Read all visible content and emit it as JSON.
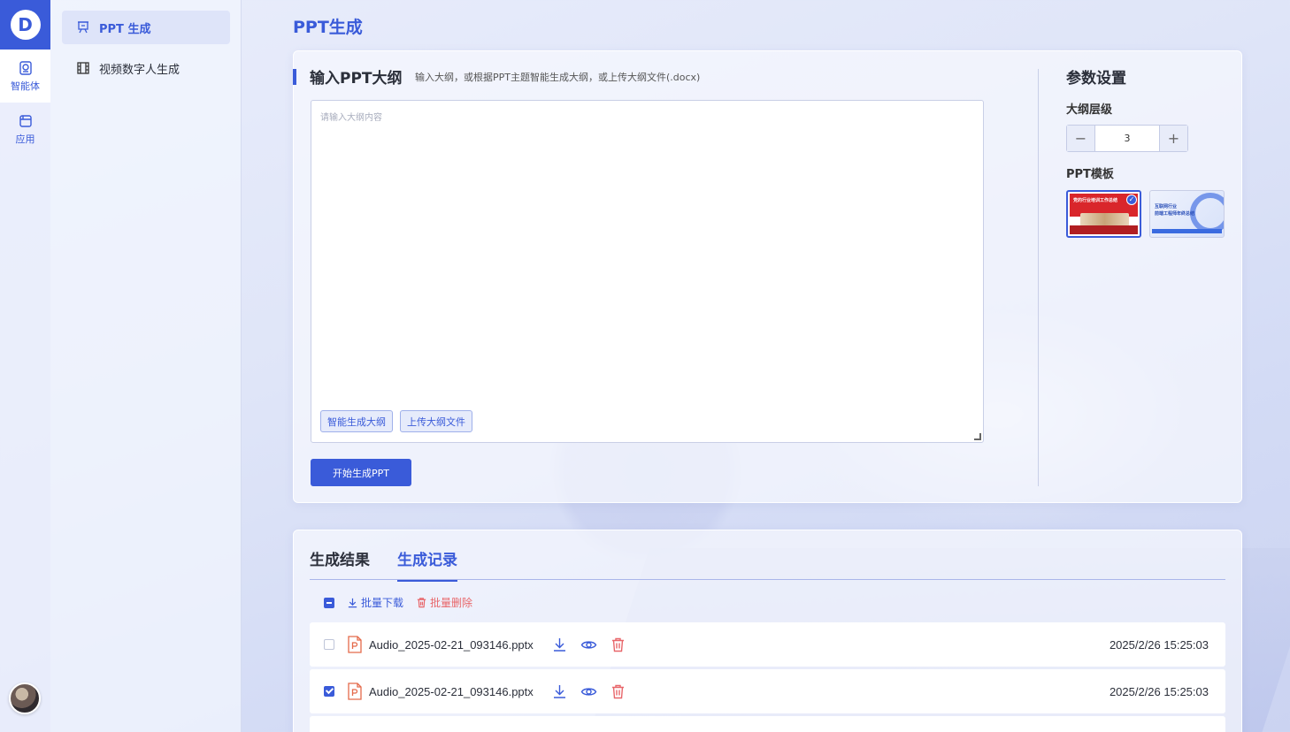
{
  "rail": {
    "items": [
      {
        "label": "智能体",
        "icon": "agent-icon"
      },
      {
        "label": "应用",
        "icon": "app-icon"
      }
    ]
  },
  "sidebar": {
    "items": [
      {
        "label": "PPT 生成",
        "icon": "presentation-icon",
        "active": true
      },
      {
        "label": "视频数字人生成",
        "icon": "film-icon",
        "active": false
      }
    ]
  },
  "page": {
    "title": "PPT生成"
  },
  "outline": {
    "title": "输入PPT大纲",
    "hint": "输入大纲，或根据PPT主题智能生成大纲，或上传大纲文件(.docx)",
    "placeholder": "请输入大纲内容",
    "smart_button": "智能生成大纲",
    "upload_button": "上传大纲文件",
    "start_button": "开始生成PPT"
  },
  "params": {
    "title": "参数设置",
    "level_label": "大纲层级",
    "level_value": "3",
    "minus": "−",
    "plus": "+",
    "template_label": "PPT模板",
    "templates": [
      {
        "title": "党的行业培训工作总结",
        "selected": true
      },
      {
        "title_line1": "互联网行业",
        "title_line2": "前端工程师年终总结",
        "selected": false
      }
    ]
  },
  "results": {
    "tabs": [
      {
        "label": "生成结果",
        "active": false
      },
      {
        "label": "生成记录",
        "active": true
      }
    ],
    "batch_download": "批量下载",
    "batch_delete": "批量删除",
    "rows": [
      {
        "name": "Audio_2025-02-21_093146.pptx",
        "time": "2025/2/26 15:25:03",
        "checked": false
      },
      {
        "name": "Audio_2025-02-21_093146.pptx",
        "time": "2025/2/26 15:25:03",
        "checked": true
      }
    ]
  },
  "colors": {
    "accent": "#3a5bd9",
    "danger": "#e8666a",
    "file_icon": "#e46a4a"
  }
}
